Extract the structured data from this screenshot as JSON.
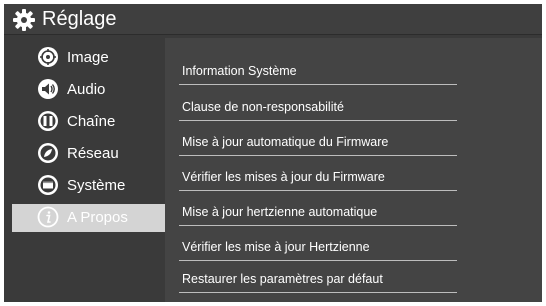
{
  "header": {
    "title": "Réglage",
    "icon": "gear-icon"
  },
  "sidebar": {
    "items": [
      {
        "label": "Image",
        "icon": "image-settings-icon",
        "selected": false
      },
      {
        "label": "Audio",
        "icon": "speaker-icon",
        "selected": false
      },
      {
        "label": "Chaîne",
        "icon": "channel-icon",
        "selected": false
      },
      {
        "label": "Réseau",
        "icon": "network-icon",
        "selected": false
      },
      {
        "label": "Système",
        "icon": "system-screen-icon",
        "selected": false
      },
      {
        "label": "A Propos",
        "icon": "info-icon",
        "selected": true
      }
    ]
  },
  "panel": {
    "options": [
      {
        "label": "Information Système"
      },
      {
        "label": "Clause de non-responsabilité"
      },
      {
        "label": "Mise à jour automatique du Firmware"
      },
      {
        "label": "Vérifier les mises à jour du Firmware"
      },
      {
        "label": "Mise à jour hertzienne automatique"
      },
      {
        "label": "Vérifier les mise à jour Hertzienne"
      },
      {
        "label": "Restaurer les paramètres par défaut"
      }
    ]
  },
  "colors": {
    "background": "#3a3a3a",
    "panel": "#444444",
    "selected": "#d4d4d4",
    "text": "#ffffff"
  }
}
